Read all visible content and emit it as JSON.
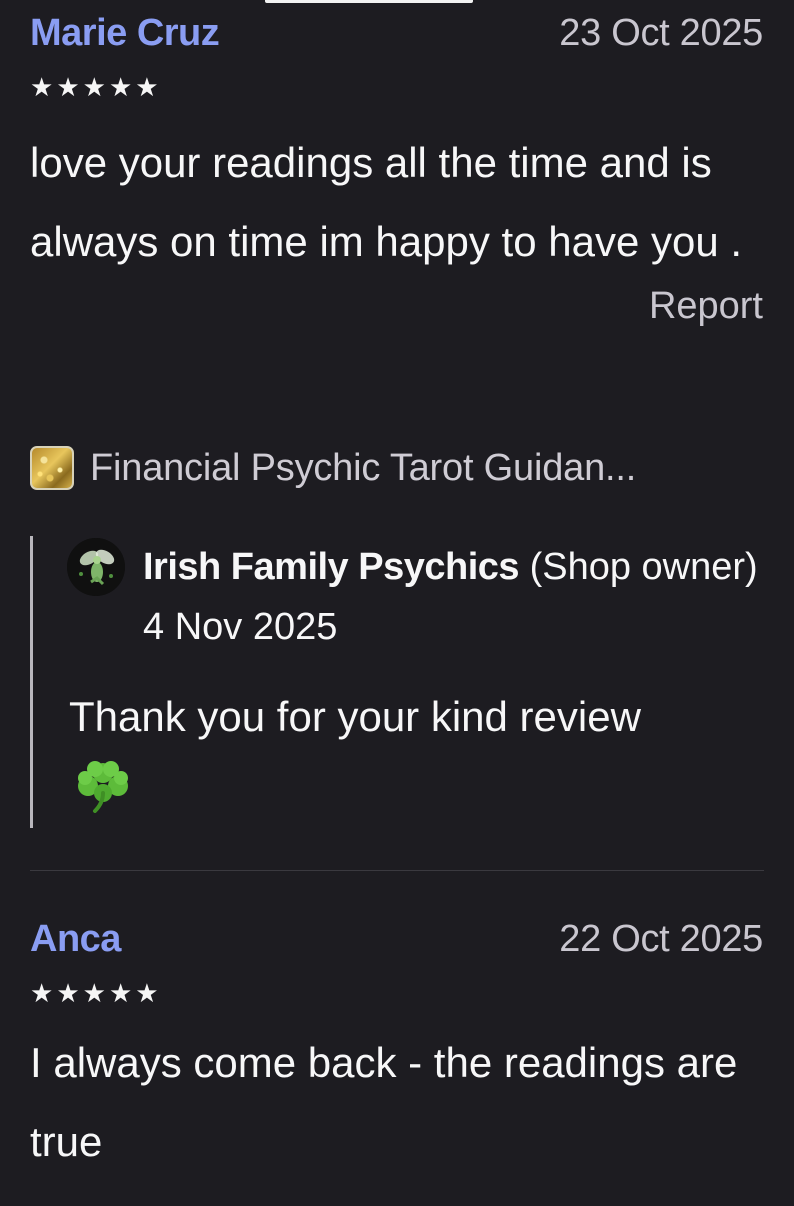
{
  "reviews": [
    {
      "reviewer": "Marie Cruz",
      "date": "23 Oct 2025",
      "rating": 5,
      "text": "love your readings all the time and is always on time im happy to have you .",
      "report_label": "Report",
      "listing_title": "Financial Psychic Tarot Guidan...",
      "reply": {
        "author": "Irish Family Psychics",
        "role": " (Shop owner)",
        "date": "4 Nov 2025",
        "text": "Thank you for your kind review",
        "emoji_icon": "shamrock-icon"
      }
    },
    {
      "reviewer": "Anca",
      "date": "22 Oct 2025",
      "rating": 5,
      "text": "I always come back - the readings are true"
    }
  ],
  "colors": {
    "background": "#1d1c21",
    "reviewer_name": "#8a9df2",
    "muted_text": "#c9c6cf",
    "body_text": "#f7f7f8",
    "reply_border": "#b9b7bd",
    "divider": "#3a393f"
  }
}
